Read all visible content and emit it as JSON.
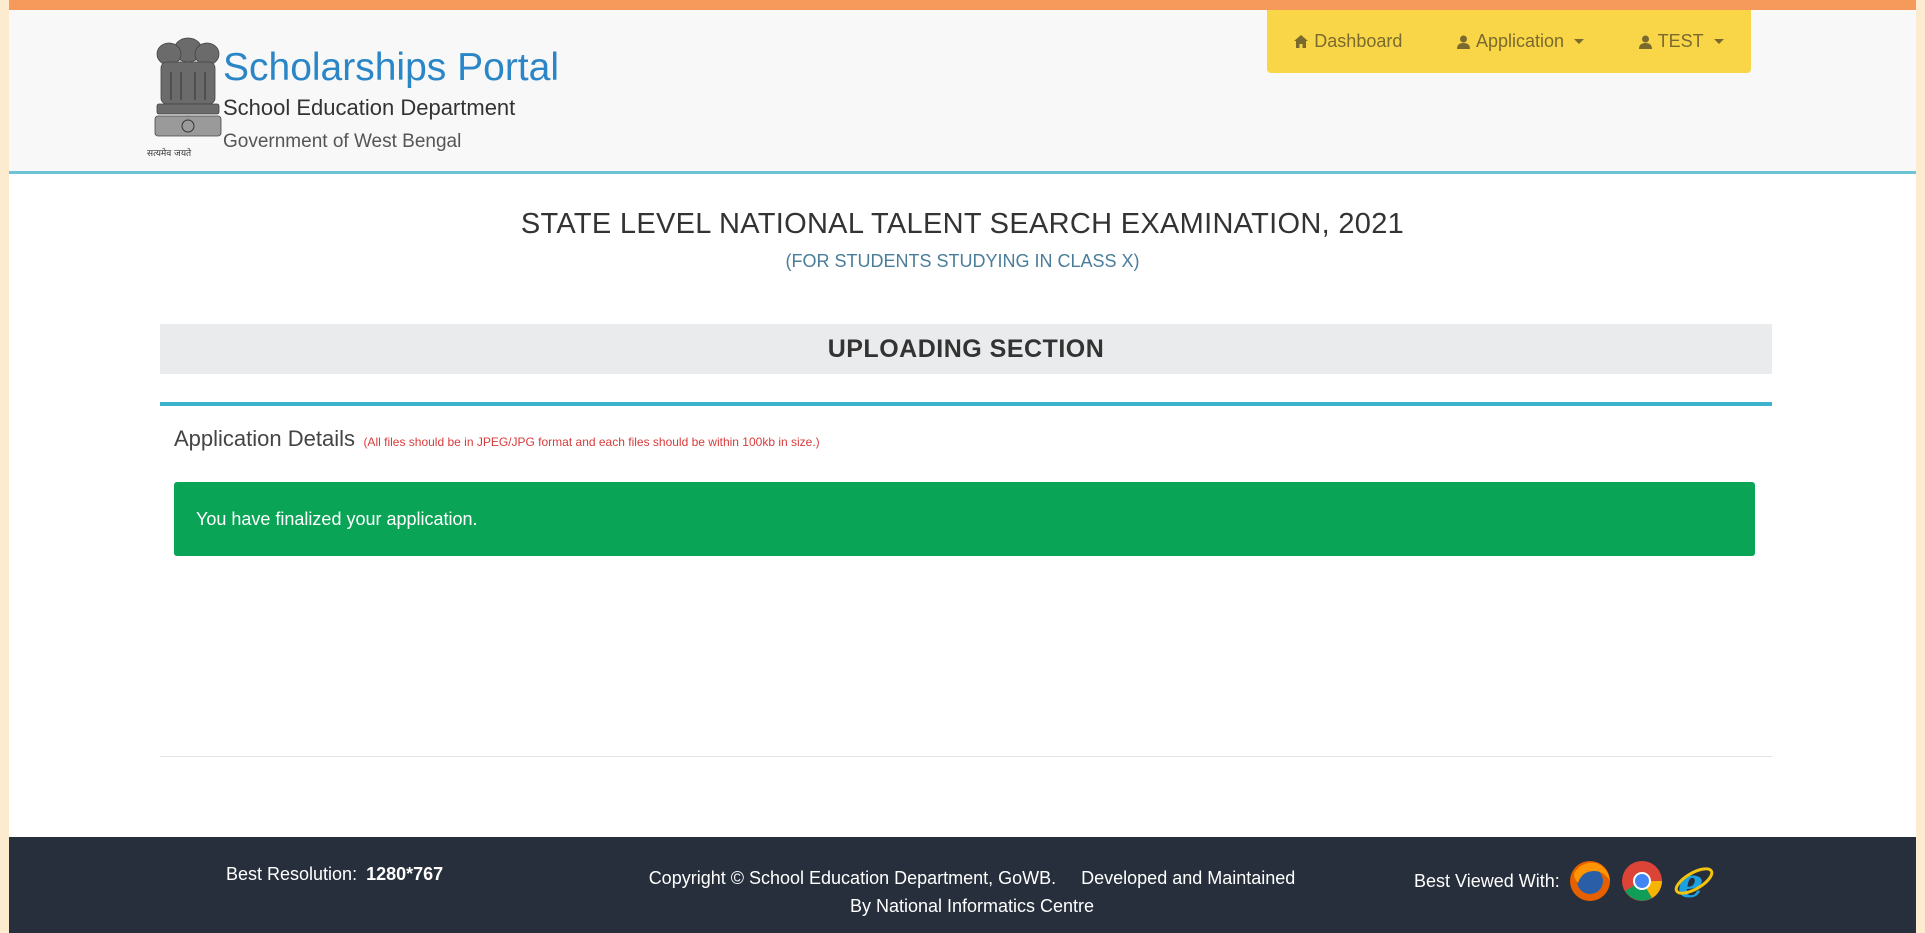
{
  "header": {
    "title": "Scholarships Portal",
    "department": "School Education Department",
    "government": "Government of West Bengal",
    "emblem_caption": "सत्यमेव जयते"
  },
  "nav": {
    "dashboard_label": "Dashboard",
    "application_label": "Application",
    "user_label": "TEST"
  },
  "page": {
    "title": "STATE LEVEL NATIONAL TALENT SEARCH EXAMINATION, 2021",
    "subtitle": "(FOR STUDENTS STUDYING IN CLASS X)",
    "section_title": "UPLOADING SECTION",
    "panel_title": "Application Details",
    "panel_note": "(All files should be in JPEG/JPG format and each files should be within 100kb in size.)",
    "alert_message": "You have finalized your application."
  },
  "footer": {
    "resolution_label": "Best Resolution:",
    "resolution_value": "1280*767",
    "copyright_line1": "Copyright © School Education Department, GoWB.     Developed and Maintained",
    "copyright_line2": "By National Informatics Centre",
    "best_viewed_label": "Best Viewed With:",
    "browsers": [
      "firefox-icon",
      "chrome-icon",
      "internet-explorer-icon"
    ]
  },
  "colors": {
    "top_strip": "#f59a5a",
    "navbar": "#f9d648",
    "brand_blue": "#2a86c6",
    "alert_green": "#0aa456",
    "panel_border": "#3cb3cd",
    "footer_bg": "#262f3b",
    "note_red": "#d83b3b"
  }
}
